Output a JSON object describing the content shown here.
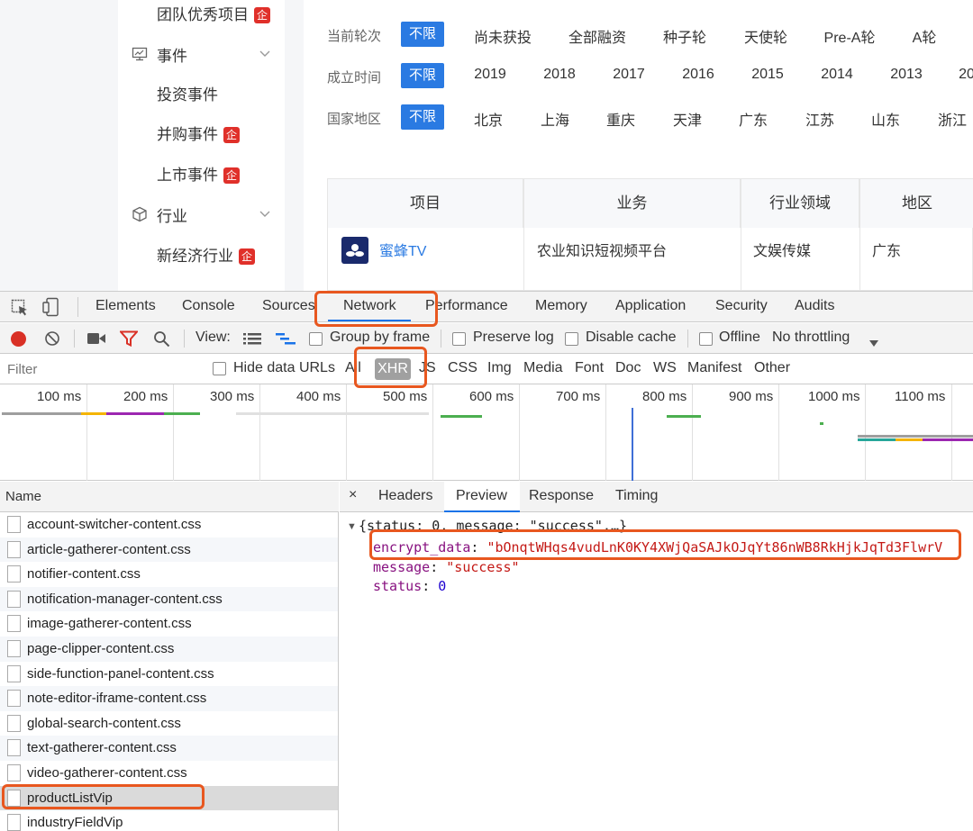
{
  "sidebar": {
    "items": [
      {
        "label": "团队优秀项目",
        "badge": "企"
      },
      {
        "label": "事件",
        "icon": "monitor-icon"
      },
      {
        "label": "投资事件"
      },
      {
        "label": "并购事件",
        "badge": "企"
      },
      {
        "label": "上市事件",
        "badge": "企"
      },
      {
        "label": "行业",
        "icon": "cube-icon"
      },
      {
        "label": "新经济行业",
        "badge": "企"
      }
    ]
  },
  "filters": [
    {
      "label": "当前轮次",
      "active": "不限",
      "options": [
        "尚未获投",
        "全部融资",
        "种子轮",
        "天使轮",
        "Pre-A轮",
        "A轮"
      ]
    },
    {
      "label": "成立时间",
      "active": "不限",
      "options": [
        "2019",
        "2018",
        "2017",
        "2016",
        "2015",
        "2014",
        "2013",
        "20"
      ]
    },
    {
      "label": "国家地区",
      "active": "不限",
      "options": [
        "北京",
        "上海",
        "重庆",
        "天津",
        "广东",
        "江苏",
        "山东",
        "浙江"
      ]
    }
  ],
  "table": {
    "headers": [
      "项目",
      "业务",
      "行业领域",
      "地区"
    ],
    "rows": [
      {
        "project": "蜜蜂TV",
        "business": "农业知识短视频平台",
        "field": "文娱传媒",
        "region": "广东"
      }
    ]
  },
  "devtools": {
    "tabs": [
      "Elements",
      "Console",
      "Sources",
      "Network",
      "Performance",
      "Memory",
      "Application",
      "Security",
      "Audits"
    ],
    "active_tab": "Network",
    "toolbar": {
      "view_label": "View:",
      "group_by_frame": "Group by frame",
      "preserve_log": "Preserve log",
      "disable_cache": "Disable cache",
      "offline": "Offline",
      "throttling": "No throttling"
    },
    "filter": {
      "placeholder": "Filter",
      "hide_data_urls": "Hide data URLs",
      "types": [
        "All",
        "XHR",
        "JS",
        "CSS",
        "Img",
        "Media",
        "Font",
        "Doc",
        "WS",
        "Manifest",
        "Other"
      ],
      "active_type": "XHR"
    },
    "timeline": {
      "ticks": [
        "100 ms",
        "200 ms",
        "300 ms",
        "400 ms",
        "500 ms",
        "600 ms",
        "700 ms",
        "800 ms",
        "900 ms",
        "1000 ms",
        "1100 ms"
      ]
    },
    "requests": {
      "header": "Name",
      "items": [
        "account-switcher-content.css",
        "article-gatherer-content.css",
        "notifier-content.css",
        "notification-manager-content.css",
        "image-gatherer-content.css",
        "page-clipper-content.css",
        "side-function-panel-content.css",
        "note-editor-iframe-content.css",
        "global-search-content.css",
        "text-gatherer-content.css",
        "video-gatherer-content.css",
        "productListVip",
        "industryFieldVip"
      ],
      "selected": "productListVip"
    },
    "detail": {
      "close": "×",
      "tabs": [
        "Headers",
        "Preview",
        "Response",
        "Timing"
      ],
      "active_tab": "Preview",
      "summary": "{status: 0, message: \"success\",…}",
      "fields": [
        {
          "key": "encrypt_data",
          "value": "\"bOnqtWHqs4vudLnK0KY4XWjQaSAJkOJqYt86nWB8RkHjkJqTd3FlwrV"
        },
        {
          "key": "message",
          "value": "\"success\""
        },
        {
          "key": "status",
          "value": "0"
        }
      ]
    }
  },
  "colors": {
    "accent_blue": "#2a7ae2",
    "badge_red": "#e0302a",
    "highlight_orange": "#e8571f"
  }
}
